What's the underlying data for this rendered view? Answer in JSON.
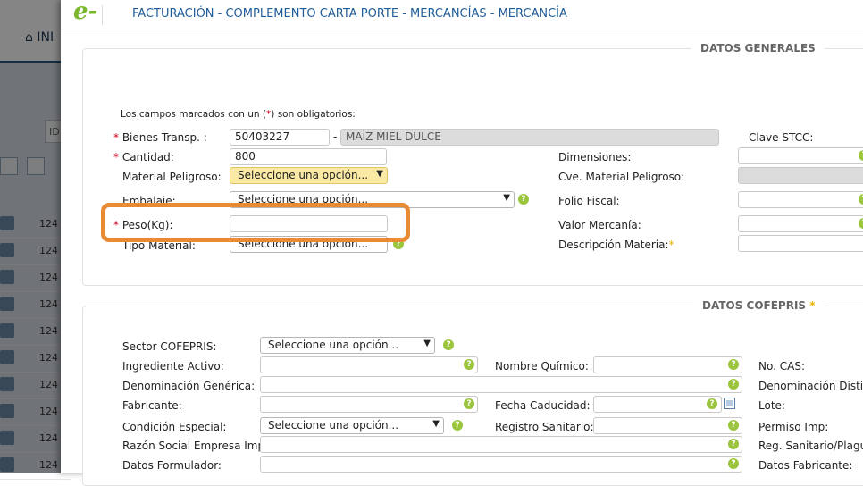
{
  "background": {
    "nav_label": "INI",
    "id_label": "ID",
    "row_ids": [
      "124",
      "124",
      "124",
      "124",
      "124",
      "124",
      "124",
      "124",
      "124",
      "124"
    ]
  },
  "header": {
    "logo": "e-",
    "title": "FACTURACIÓN - COMPLEMENTO CARTA PORTE - MERCANCÍAS - MERCANCÍA"
  },
  "generales": {
    "legend": "DATOS GENERALES",
    "required_note_pre": "Los campos marcados con un (",
    "required_note_mark": "*",
    "required_note_post": ") son obligatorios:",
    "bienes_label": "Bienes Transp. :",
    "bienes_code": "50403227",
    "bienes_sep": "-",
    "bienes_desc": "MAÍZ  MIEL DULCE",
    "clave_stcc_label": "Clave STCC:",
    "cantidad_label": "Cantidad:",
    "cantidad_value": "800",
    "dimensiones_label": "Dimensiones:",
    "material_peligroso_label": "Material Peligroso:",
    "material_peligroso_value": "Seleccione una opción...",
    "cve_material_label": "Cve. Material Peligroso:",
    "embalaje_label": "Embalaje:",
    "embalaje_value": "Seleccione una opción...",
    "folio_fiscal_label": "Folio Fiscal:",
    "peso_label": "Peso(Kg):",
    "peso_value": "",
    "valor_mercancia_label": "Valor Mercanía:",
    "tipo_material_label": "Tipo Material:",
    "tipo_material_value": "Seleccione una opción...",
    "descripcion_materia_label": "Descripción Materia:",
    "asterisk": "*"
  },
  "cofepris": {
    "legend": "DATOS COFEPRIS",
    "legend_mark": "*",
    "sector_label": "Sector COFEPRIS:",
    "sector_value": "Seleccione una opción...",
    "ingrediente_label": "Ingrediente Activo:",
    "nombre_quimico_label": "Nombre Químico:",
    "no_cas_label": "No. CAS:",
    "denominacion_generica_label": "Denominación Genérica:",
    "denominacion_distintiva_label": "Denominación Distin",
    "fabricante_label": "Fabricante:",
    "fecha_caducidad_label": "Fecha Caducidad:",
    "lote_label": "Lote:",
    "condicion_especial_label": "Condición Especial:",
    "condicion_especial_value": "Seleccione una opción...",
    "registro_sanitario_label": "Registro Sanitario:",
    "permiso_imp_label": "Permiso Imp:",
    "razon_social_label": "Razón Social Empresa Imp:",
    "reg_sanitario_plaguicida_label": "Reg. Sanitario/Plaguic",
    "datos_formulador_label": "Datos Formulador:",
    "datos_fabricante_label": "Datos Fabricante:"
  },
  "colors": {
    "title": "#1f5c99",
    "highlight": "#e88b33",
    "help_icon": "#9bc53d",
    "required": "#d0021b"
  }
}
